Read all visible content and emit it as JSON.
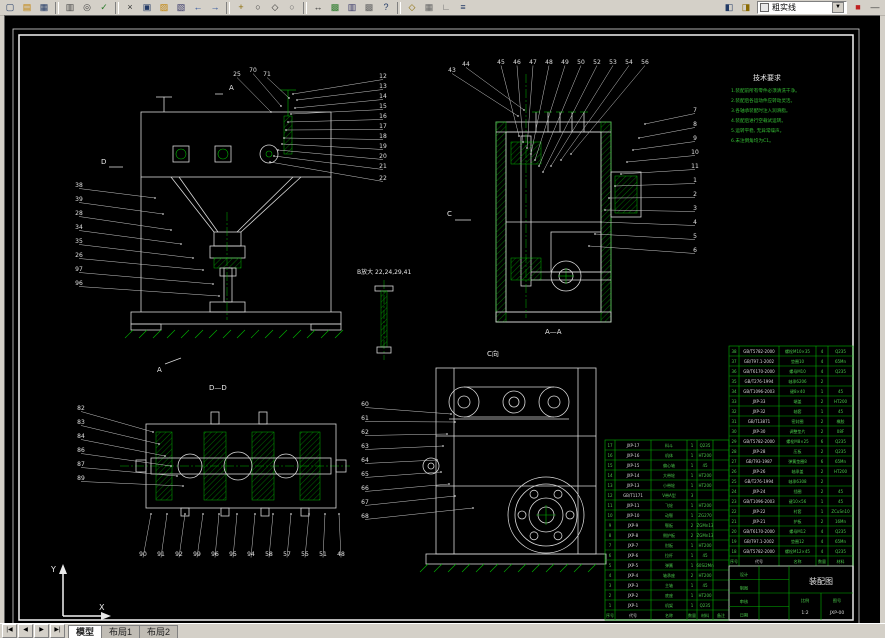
{
  "app": {
    "layer_combo": {
      "value": "粗实线"
    },
    "toolbar_groups": [
      [
        "new",
        "open",
        "save"
      ],
      [
        "print",
        "preview",
        "spell"
      ],
      [
        "cut",
        "copy",
        "paste",
        "match",
        "undo",
        "redo"
      ],
      [
        "pan",
        "zoom",
        "zoom-window",
        "zoom-prev"
      ],
      [
        "distance",
        "redraw",
        "properties",
        "toolbox",
        "help"
      ],
      [
        "osnap",
        "grid",
        "ortho",
        "layers"
      ]
    ],
    "toolbar_right": [
      "layer-states",
      "make-layer"
    ],
    "toolbar_right2": [
      "color-control",
      "linetype-control"
    ],
    "tabs": {
      "nav": [
        "|◀",
        "◀",
        "▶",
        "▶|"
      ],
      "items": [
        "模型",
        "布局1",
        "布局2"
      ],
      "active": 0
    },
    "ucs": {
      "x": "X",
      "y": "Y"
    }
  },
  "drawing": {
    "labels": {
      "section_aa": "A—A",
      "section_dd": "D—D",
      "view_c": "C向",
      "detail_b": "B放大 22,24,29,41",
      "datum_a_top": "A",
      "datum_a_bottom": "A",
      "datum_d": "D",
      "datum_c": "C"
    },
    "notes": {
      "title": "技术要求",
      "lines": [
        "1.装配前所有零件必须清洗干净。",
        "2.装配后各运动件应转动灵活。",
        "3.各轴承装配时注入润滑脂。",
        "4.装配后进行空载试运转。",
        "5.运转平稳, 无异常噪声。",
        "6.未注倒角均为C1。"
      ]
    },
    "callouts": {
      "g1_top": [
        "25",
        "70",
        "71"
      ],
      "g1_right": [
        "12",
        "13",
        "14",
        "15",
        "16",
        "17",
        "18",
        "19",
        "20",
        "21",
        "22"
      ],
      "g1_left": [
        "38",
        "39",
        "28",
        "34",
        "35",
        "26",
        "97",
        "96"
      ],
      "g2_topleft": [
        "43",
        "44"
      ],
      "g2_top": [
        "45",
        "46",
        "47",
        "48",
        "49",
        "50",
        "52",
        "53",
        "54",
        "56"
      ],
      "g2_right": [
        "7",
        "8",
        "9",
        "10",
        "11",
        "1",
        "2",
        "3",
        "4",
        "5",
        "6"
      ],
      "g3_left": [
        "82",
        "83",
        "84",
        "86",
        "87",
        "89"
      ],
      "g3_bottom": [
        "90",
        "91",
        "92",
        "99",
        "96",
        "95",
        "94",
        "58",
        "57",
        "55",
        "51",
        "48"
      ],
      "g4_left": [
        "60",
        "61",
        "62",
        "63",
        "64",
        "65",
        "66",
        "67",
        "68"
      ]
    },
    "bom": {
      "headers": [
        "序号",
        "代号",
        "名称",
        "数量",
        "材料",
        "备注"
      ],
      "tableA": [
        [
          "38",
          "GB/T5782-2000",
          "螺栓M10×35",
          "4",
          "Q235"
        ],
        [
          "37",
          "GB/T97.1-2002",
          "垫圈10",
          "4",
          "65Mn"
        ],
        [
          "36",
          "GB/T6170-2000",
          "螺母M10",
          "4",
          "Q235"
        ],
        [
          "35",
          "GB/T276-1994",
          "轴承6206",
          "2",
          ""
        ],
        [
          "34",
          "GB/T1096-2003",
          "键8×40",
          "1",
          "45"
        ],
        [
          "33",
          "JXP-33",
          "端盖",
          "2",
          "HT200"
        ],
        [
          "32",
          "JXP-32",
          "轴套",
          "1",
          "45"
        ],
        [
          "31",
          "GB/T13871",
          "密封圈",
          "2",
          "橡胶"
        ],
        [
          "30",
          "JXP-30",
          "调整垫片",
          "2",
          "08F"
        ],
        [
          "29",
          "GB/T5782-2000",
          "螺栓M8×25",
          "6",
          "Q235"
        ],
        [
          "28",
          "JXP-28",
          "压板",
          "2",
          "Q235"
        ],
        [
          "27",
          "GB/T93-1987",
          "弹簧垫圈8",
          "6",
          "65Mn"
        ],
        [
          "26",
          "JXP-26",
          "轴承盖",
          "2",
          "HT200"
        ],
        [
          "25",
          "GB/T276-1994",
          "轴承6308",
          "2",
          ""
        ],
        [
          "24",
          "JXP-24",
          "挡圈",
          "2",
          "45"
        ],
        [
          "23",
          "GB/T1096-2003",
          "键10×56",
          "1",
          "45"
        ],
        [
          "22",
          "JXP-22",
          "衬套",
          "1",
          "ZCuSn10"
        ],
        [
          "21",
          "JXP-21",
          "护板",
          "2",
          "16Mn"
        ],
        [
          "20",
          "GB/T6170-2000",
          "螺母M12",
          "4",
          "Q235"
        ],
        [
          "19",
          "GB/T97.1-2002",
          "垫圈12",
          "4",
          "65Mn"
        ],
        [
          "18",
          "GB/T5782-2000",
          "螺栓M12×45",
          "4",
          "Q235"
        ]
      ],
      "tableB": [
        [
          "17",
          "JXP-17",
          "料斗",
          "1",
          "Q235",
          ""
        ],
        [
          "16",
          "JXP-16",
          "机体",
          "1",
          "HT200",
          ""
        ],
        [
          "15",
          "JXP-15",
          "偏心轴",
          "1",
          "45",
          ""
        ],
        [
          "14",
          "JXP-14",
          "大带轮",
          "1",
          "HT200",
          ""
        ],
        [
          "13",
          "JXP-13",
          "小带轮",
          "1",
          "HT200",
          ""
        ],
        [
          "12",
          "GB/T1171",
          "V带A型",
          "3",
          "",
          ""
        ],
        [
          "11",
          "JXP-11",
          "飞轮",
          "1",
          "HT200",
          ""
        ],
        [
          "10",
          "JXP-10",
          "动颚",
          "1",
          "ZG270",
          ""
        ],
        [
          "9",
          "JXP-9",
          "颚板",
          "2",
          "ZGMn13",
          ""
        ],
        [
          "8",
          "JXP-8",
          "侧护板",
          "2",
          "ZGMn13",
          ""
        ],
        [
          "7",
          "JXP-7",
          "肘板",
          "1",
          "HT200",
          ""
        ],
        [
          "6",
          "JXP-6",
          "拉杆",
          "1",
          "45",
          ""
        ],
        [
          "5",
          "JXP-5",
          "弹簧",
          "1",
          "60Si2Mn",
          ""
        ],
        [
          "4",
          "JXP-4",
          "轴承座",
          "2",
          "HT200",
          ""
        ],
        [
          "3",
          "JXP-3",
          "主轴",
          "1",
          "45",
          ""
        ],
        [
          "2",
          "JXP-2",
          "底座",
          "1",
          "HT200",
          ""
        ],
        [
          "1",
          "JXP-1",
          "机架",
          "1",
          "Q235",
          ""
        ]
      ]
    },
    "titleblock": {
      "title": "装配图",
      "fields": [
        [
          "设计",
          ""
        ],
        [
          "制图",
          ""
        ],
        [
          "审核",
          ""
        ],
        [
          "日期",
          ""
        ]
      ],
      "scale_label": "比例",
      "scale": "1:2",
      "sheet_label": "图号",
      "sheet": "JXP-00"
    }
  }
}
